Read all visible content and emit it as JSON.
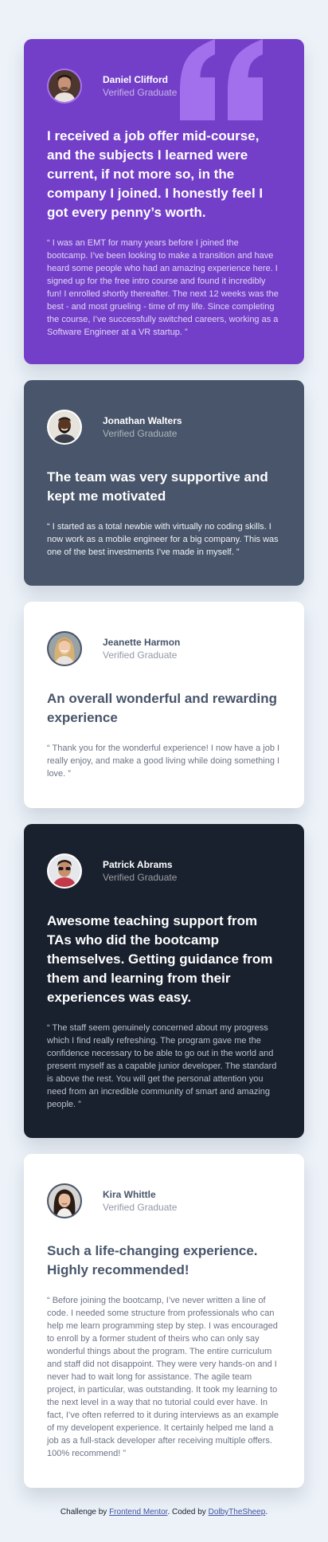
{
  "testimonials": [
    {
      "name": "Daniel Clifford",
      "role": "Verified Graduate",
      "headline": "I received a job offer mid-course, and the subjects I learned were current, if not more so, in the company I joined. I honestly feel I got every penny’s worth.",
      "body": "“ I was an EMT for many years before I joined the bootcamp. I’ve been looking to make a transition and have heard some people who had an amazing experience here. I signed up for the free intro course and found it incredibly fun! I enrolled shortly thereafter. The next 12 weeks was the best - and most grueling - time of my life. Since completing the course, I’ve successfully switched careers, working as a Software Engineer at a VR startup. ”"
    },
    {
      "name": "Jonathan Walters",
      "role": "Verified Graduate",
      "headline": "The team was very supportive and kept me motivated",
      "body": "“ I started as a total newbie with virtually no coding skills. I now work as a mobile engineer for a big company. This was one of the best investments I’ve made in myself. ”"
    },
    {
      "name": "Jeanette Harmon",
      "role": "Verified Graduate",
      "headline": "An overall wonderful and rewarding experience",
      "body": "“ Thank you for the wonderful experience! I now have a job I really enjoy, and make a good living while doing something I love. ”"
    },
    {
      "name": "Patrick Abrams",
      "role": "Verified Graduate",
      "headline": "Awesome teaching support from TAs who did the bootcamp themselves. Getting guidance from them and learning from their experiences was easy.",
      "body": "“ The staff seem genuinely concerned about my progress which I find really refreshing. The program gave me the confidence necessary to be able to go out in the world and present myself as a capable junior developer. The standard is above the rest. You will get the personal attention you need from an incredible community of smart and amazing people. ”"
    },
    {
      "name": "Kira Whittle",
      "role": "Verified Graduate",
      "headline": "Such a life-changing experience. Highly recommended!",
      "body": "“ Before joining the bootcamp, I’ve never written a line of code. I needed some structure from professionals who can help me learn programming step by step. I was encouraged to enroll by a former student of theirs who can only say wonderful things about the program. The entire curriculum and staff did not disappoint. They were very hands-on and I never had to wait long for assistance. The agile team project, in particular, was outstanding. It took my learning to the next level in a way that no tutorial could ever have. In fact, I’ve often referred to it during interviews as an example of my developent experience. It certainly helped me land a job as a full-stack developer after receiving multiple offers. 100% recommend! ”"
    }
  ],
  "footer": {
    "prefix": "Challenge by ",
    "link1": "Frontend Mentor",
    "middle": ". Coded by ",
    "link2": "DolbyTheSheep",
    "suffix": "."
  },
  "colors": {
    "purple": "#733fc8",
    "gray_blue": "#48556a",
    "white": "#ffffff",
    "dark_blue": "#19212e",
    "background": "#ecf2f8"
  },
  "icons": {
    "quotation": "quotation-mark-icon"
  }
}
